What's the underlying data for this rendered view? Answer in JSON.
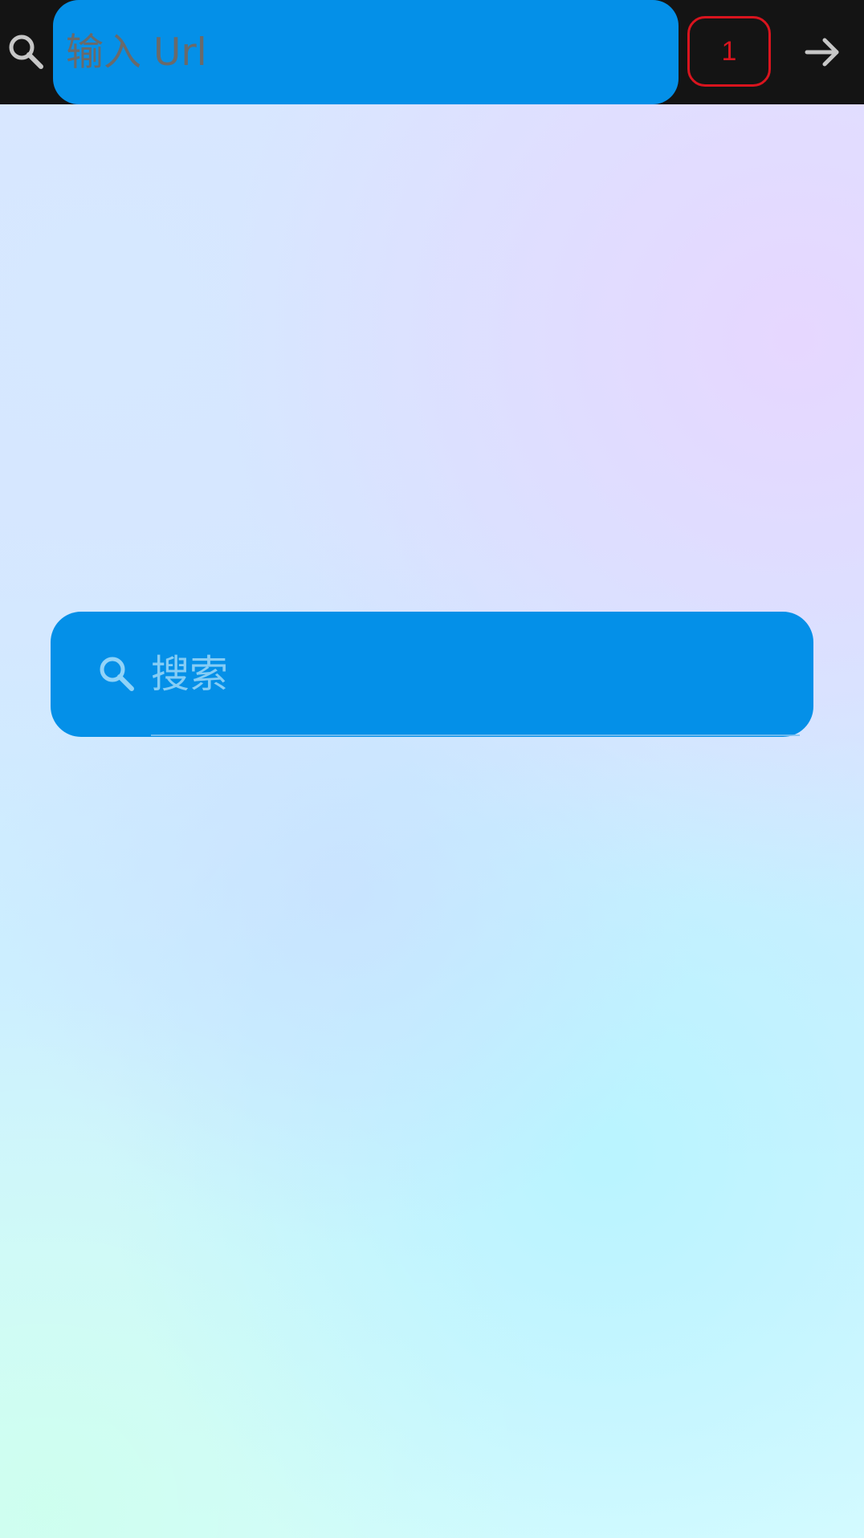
{
  "topbar": {
    "search_icon": "search-icon",
    "url_placeholder": "输入 Url",
    "tab_count": "1",
    "go_icon": "arrow-right-icon"
  },
  "main": {
    "search_icon": "search-icon",
    "search_placeholder": "搜索"
  },
  "colors": {
    "topbar_bg": "#141414",
    "accent": "#0490E8",
    "tab_counter": "#D9141E",
    "url_placeholder": "#6A6A6A",
    "search_placeholder": "#86CDF5"
  }
}
